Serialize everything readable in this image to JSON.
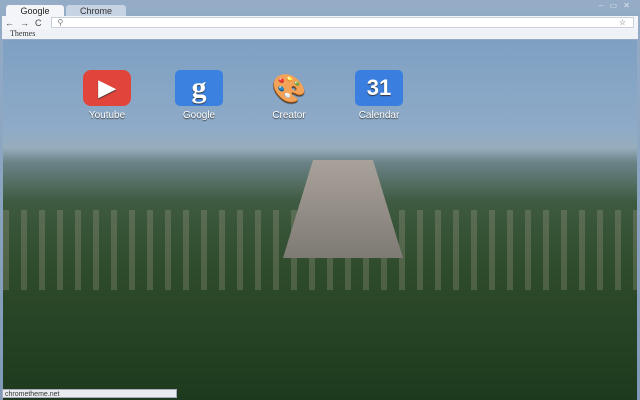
{
  "tabs": [
    {
      "label": "Google"
    },
    {
      "label": "Chrome"
    }
  ],
  "window_controls": "– ▭ ✕",
  "toolbar": {
    "back": "←",
    "forward": "→",
    "reload": "C",
    "search_icon": "⚲",
    "star": "☆"
  },
  "bookmarks": [
    {
      "label": "Themes"
    }
  ],
  "apps": [
    {
      "label": "Youtube",
      "glyph": "▶"
    },
    {
      "label": "Google",
      "glyph": "g"
    },
    {
      "label": "Creator",
      "glyph": "🎨"
    },
    {
      "label": "Calendar",
      "glyph": "31"
    }
  ],
  "status": "chrometheme.net"
}
